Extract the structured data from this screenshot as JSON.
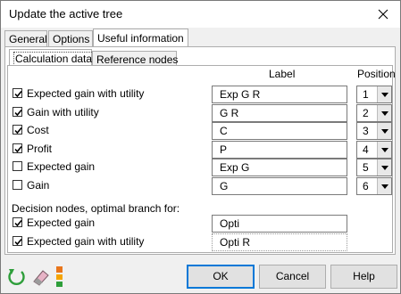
{
  "window": {
    "title": "Update the active tree"
  },
  "tabs": [
    {
      "label": "General"
    },
    {
      "label": "Options"
    },
    {
      "label": "Useful information"
    }
  ],
  "subtabs": [
    {
      "label": "Calculation data"
    },
    {
      "label": "Reference nodes"
    }
  ],
  "columns": {
    "label": "Label",
    "position": "Position"
  },
  "calc_rows": [
    {
      "name": "Expected gain with utility",
      "checked": true,
      "value": "Exp G R",
      "position": "1"
    },
    {
      "name": "Gain with utility",
      "checked": true,
      "value": "G R",
      "position": "2"
    },
    {
      "name": "Cost",
      "checked": true,
      "value": "C",
      "position": "3"
    },
    {
      "name": "Profit",
      "checked": true,
      "value": "P",
      "position": "4"
    },
    {
      "name": "Expected gain",
      "checked": false,
      "value": "Exp G",
      "position": "5"
    },
    {
      "name": "Gain",
      "checked": false,
      "value": "G",
      "position": "6"
    }
  ],
  "decision": {
    "heading": "Decision nodes, optimal branch for:",
    "rows": [
      {
        "name": "Expected gain",
        "checked": true,
        "value": "Opti"
      },
      {
        "name": "Expected gain with utility",
        "checked": true,
        "value": "Opti R"
      }
    ]
  },
  "buttons": {
    "ok": "OK",
    "cancel": "Cancel",
    "help": "Help"
  },
  "icons": {
    "refresh": "refresh-icon",
    "eraser": "eraser-icon",
    "colors": "color-swatch-icon"
  }
}
